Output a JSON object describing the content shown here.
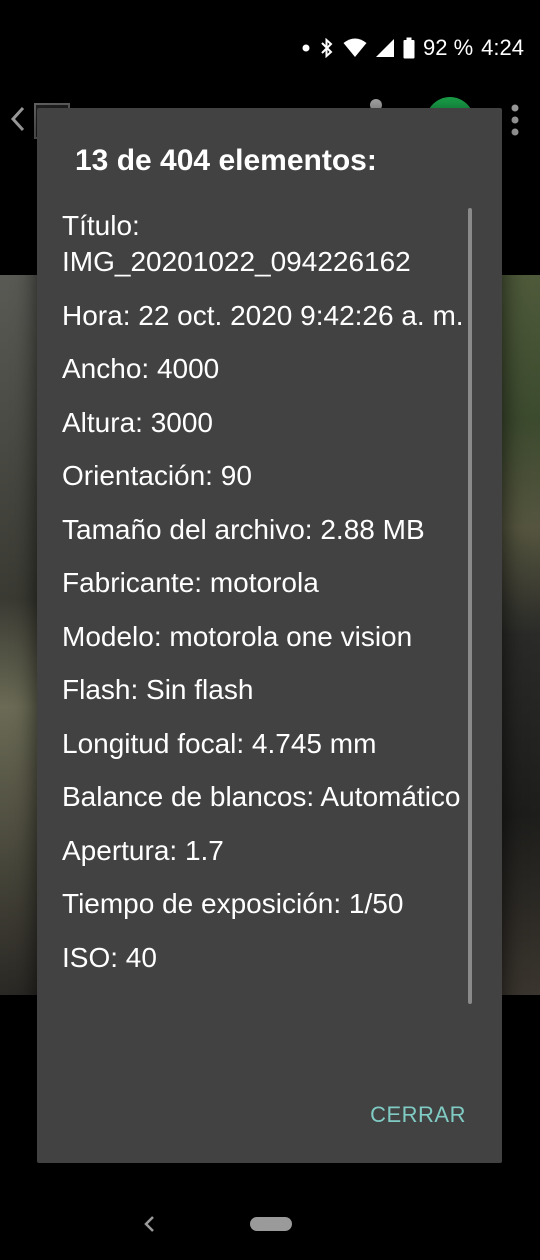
{
  "status_bar": {
    "battery_percent": "92 %",
    "time": "4:24"
  },
  "dialog": {
    "title": "13 de 404 elementos:",
    "close_label": "CERRAR",
    "details": [
      "Título: IMG_20201022_094226162",
      "Hora: 22 oct. 2020 9:42:26 a. m.",
      "Ancho: 4000",
      "Altura: 3000",
      "Orientación: 90",
      "Tamaño del archivo: 2.88 MB",
      "Fabricante: motorola",
      "Modelo: motorola one vision",
      "Flash: Sin flash",
      "Longitud focal: 4.745 mm",
      "Balance de blancos: Automático",
      "Apertura: 1.7",
      "Tiempo de exposición: 1/50",
      "ISO: 40"
    ]
  },
  "colors": {
    "dialog_background": "#424242",
    "accent": "#80cbc4",
    "background": "#000000"
  },
  "icons": {
    "status": [
      "notification-dot-icon",
      "bluetooth-icon",
      "wifi-icon",
      "cellular-signal-icon",
      "battery-icon"
    ],
    "toolbar": [
      "back-arrow-icon",
      "more-vert-icon"
    ],
    "navigation": [
      "nav-back-icon",
      "nav-home-pill-icon"
    ]
  }
}
